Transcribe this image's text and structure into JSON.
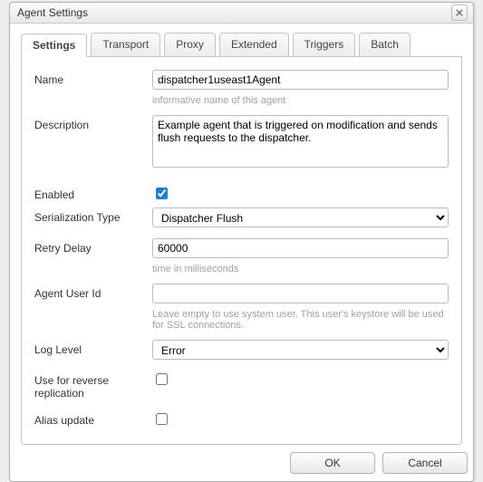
{
  "dialog": {
    "title": "Agent Settings",
    "ok_label": "OK",
    "cancel_label": "Cancel"
  },
  "tabs": {
    "settings": "Settings",
    "transport": "Transport",
    "proxy": "Proxy",
    "extended": "Extended",
    "triggers": "Triggers",
    "batch": "Batch",
    "active": "settings"
  },
  "settings": {
    "name": {
      "label": "Name",
      "value": "dispatcher1useast1Agent",
      "hint": "informative name of this agent"
    },
    "description": {
      "label": "Description",
      "value": "Example agent that is triggered on modification and sends flush requests to the dispatcher."
    },
    "enabled": {
      "label": "Enabled",
      "checked": true
    },
    "serialization_type": {
      "label": "Serialization Type",
      "value": "Dispatcher Flush",
      "options": [
        "Dispatcher Flush"
      ]
    },
    "retry_delay": {
      "label": "Retry Delay",
      "value": "60000",
      "hint": "time in milliseconds"
    },
    "agent_user_id": {
      "label": "Agent User Id",
      "value": "",
      "hint": "Leave empty to use system user. This user's keystore will be used for SSL connections."
    },
    "log_level": {
      "label": "Log Level",
      "value": "Error",
      "options": [
        "Error"
      ]
    },
    "use_reverse": {
      "label": "Use for reverse replication",
      "checked": false
    },
    "alias_update": {
      "label": "Alias update",
      "checked": false
    }
  }
}
